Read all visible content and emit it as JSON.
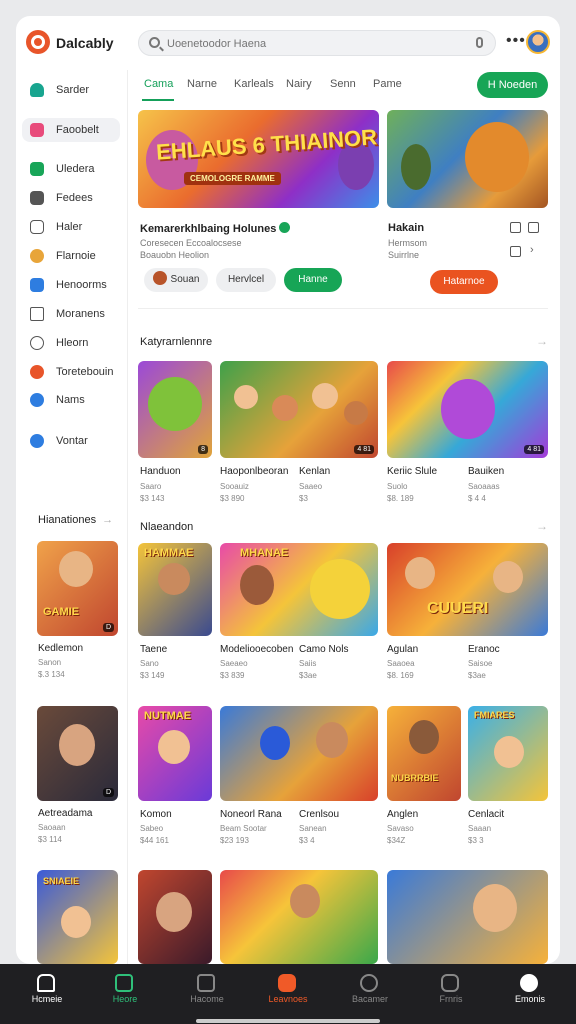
{
  "app": {
    "brand": "Dalcably"
  },
  "search": {
    "placeholder": "Uoenetoodor Haena"
  },
  "sidebar": {
    "items": [
      {
        "label": "Sarder",
        "icon": "home-icon",
        "color": "#18a58f"
      },
      {
        "label": "Faoobelt",
        "icon": "library-icon",
        "color": "#e84b7b"
      },
      {
        "label": "Uledera",
        "icon": "store-icon",
        "color": "#18a558"
      },
      {
        "label": "Fedees",
        "icon": "feed-icon",
        "color": "#555555"
      },
      {
        "label": "Haler",
        "icon": "puzzle-icon",
        "color": "#555555"
      },
      {
        "label": "Flarnoie",
        "icon": "game-icon",
        "color": "#e8a53a"
      },
      {
        "label": "Henoorms",
        "icon": "chat-icon",
        "color": "#2e7de0"
      },
      {
        "label": "Moranens",
        "icon": "book-icon",
        "color": "#555555"
      },
      {
        "label": "Hleorn",
        "icon": "gift-icon",
        "color": "#555555"
      },
      {
        "label": "Toretebouin",
        "icon": "trophy-icon",
        "color": "#e8552a"
      },
      {
        "label": "Nams",
        "icon": "info-icon",
        "color": "#2e7de0"
      },
      {
        "label": "Vontar",
        "icon": "settings-icon",
        "color": "#2e7de0"
      }
    ],
    "section": "Hianationes"
  },
  "tabs": [
    {
      "label": "Cama",
      "active": true
    },
    {
      "label": "Narne"
    },
    {
      "label": "Karleals"
    },
    {
      "label": "Nairy"
    },
    {
      "label": "Senn"
    },
    {
      "label": "Pame"
    }
  ],
  "cta": {
    "label": "H Noeden"
  },
  "featured": {
    "hero_title": "EHLAUS 6 THIAINOR",
    "hero_sub": "CEMOLOGRE RAMME",
    "left": {
      "title": "Kemarerkhlbaing Holunes",
      "meta": "Coresecen Eccoalocsese",
      "meta2": "Boauobn Heolion",
      "chips": [
        "Souan",
        "Hervlcel",
        "Hanne"
      ]
    },
    "right": {
      "title": "Hakain",
      "meta": "Hermsom",
      "meta2": "Suirrlne",
      "chip": "Hatarnoe"
    }
  },
  "section1": {
    "title": "Katyrarnlennre",
    "items": [
      {
        "name": "Handuon",
        "sub": "Saaro",
        "price": "$3 143",
        "badge": "8"
      },
      {
        "name": "Haoponlbeoran",
        "sub": "Sooauiz",
        "price": "$3 890",
        "badge": "4 81"
      },
      {
        "name": "Kenlan",
        "sub": "Saaeo",
        "price": "$3",
        "badge": ""
      },
      {
        "name": "Keriic Slule",
        "sub": "Suolo",
        "price": "$8. 189",
        "badge": "4 81"
      },
      {
        "name": "Bauiken",
        "sub": "Saoaaas",
        "price": "$ 4 4",
        "badge": ""
      }
    ]
  },
  "section2": {
    "title": "Nlaeandon",
    "items": [
      {
        "name": "Kedlemon",
        "sub": "Sanon",
        "price": "$.3 134",
        "badge": "D",
        "tile_text": "GAMIE"
      },
      {
        "name": "Taene",
        "sub": "Sano",
        "price": "$3 149",
        "badge": "",
        "tile_text": "HAMMAE"
      },
      {
        "name": "Modeliooecoben",
        "sub": "Saeaeo",
        "price": "$3 839",
        "badge": "",
        "tile_text": "MHANAE"
      },
      {
        "name": "Camo Nols",
        "sub": "Saiis",
        "price": "$3ae",
        "badge": "",
        "tile_text": ""
      },
      {
        "name": "Agulan",
        "sub": "Saaoea",
        "price": "$8. 169",
        "badge": "",
        "tile_text": "CUUERI"
      },
      {
        "name": "Eranoc",
        "sub": "Saisoe",
        "price": "$3ae",
        "badge": "",
        "tile_text": ""
      }
    ]
  },
  "section3": {
    "items": [
      {
        "name": "Aetreadama",
        "sub": "Saoaan",
        "price": "$3 114",
        "badge": "D"
      },
      {
        "name": "Komon",
        "sub": "Sabeo",
        "price": "$44 161",
        "badge": "",
        "tile_text": "NUTMAE"
      },
      {
        "name": "Noneorl Rana",
        "sub": "Beam Sootar",
        "price": "$23 193",
        "badge": "",
        "tile_text": ""
      },
      {
        "name": "Crenlsou",
        "sub": "Sanean",
        "price": "$3 4",
        "badge": "",
        "tile_text": ""
      },
      {
        "name": "Anglen",
        "sub": "Savaso",
        "price": "$34Z",
        "badge": "",
        "tile_text": "NUBRRBIE"
      },
      {
        "name": "Cenlacit",
        "sub": "Saaan",
        "price": "$3 3",
        "badge": "",
        "tile_text": "FMIARES"
      }
    ]
  },
  "section4": {
    "tiles": [
      {
        "tile_text": "SNIAEIE"
      },
      {
        "tile_text": ""
      },
      {
        "tile_text": ""
      },
      {
        "tile_text": ""
      }
    ]
  },
  "bottom_nav": [
    {
      "label": "Hcmeie",
      "icon": "home-icon"
    },
    {
      "label": "Heore",
      "icon": "store-icon",
      "active": true
    },
    {
      "label": "Hacome",
      "icon": "grid-icon"
    },
    {
      "label": "Leavnoes",
      "icon": "live-icon"
    },
    {
      "label": "Bacamer",
      "icon": "search-icon"
    },
    {
      "label": "Frnris",
      "icon": "chat-icon"
    },
    {
      "label": "Emonis",
      "icon": "profile-icon"
    }
  ]
}
